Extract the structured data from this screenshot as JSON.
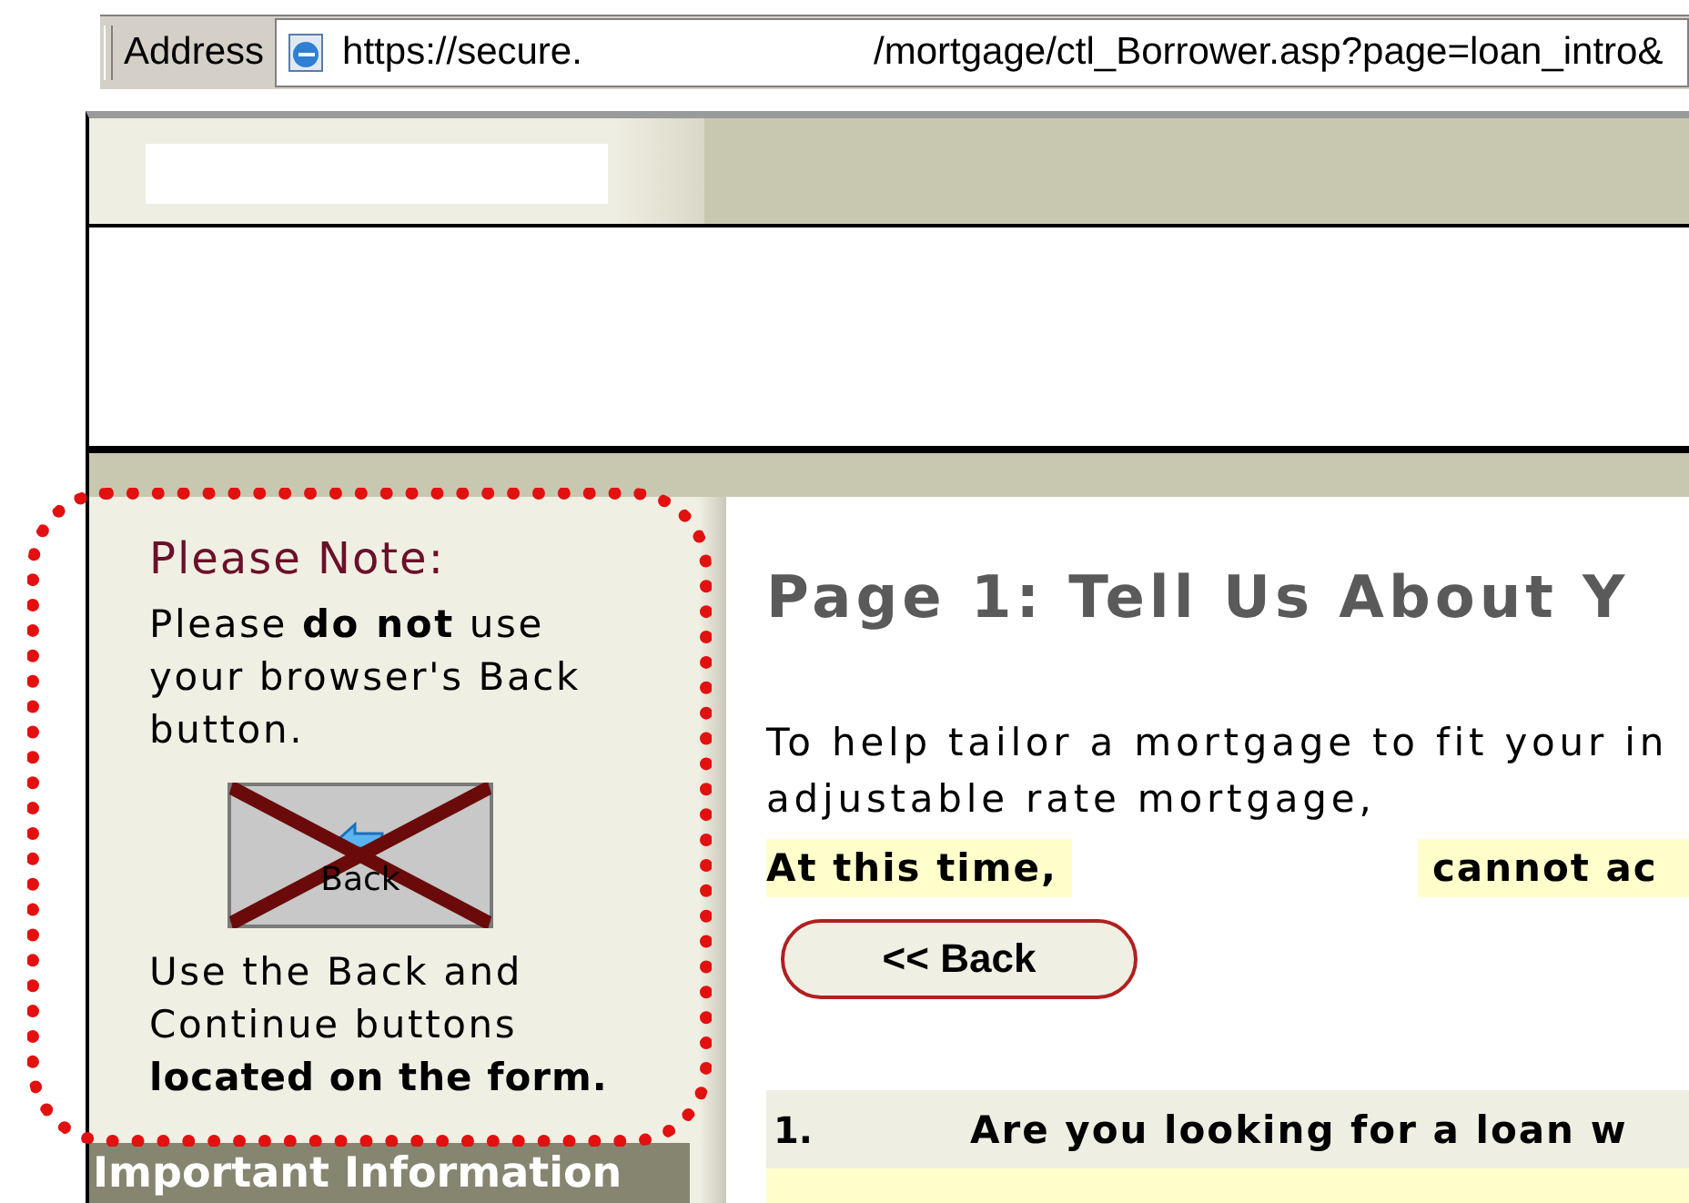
{
  "address_bar": {
    "label": "Address",
    "url_start": "https://secure.",
    "url_end": "/mortgage/ctl_Borrower.asp?page=loan_intro&"
  },
  "sidebar": {
    "note_title": "Please Note:",
    "note_text": "Please **do not** use your browser's Back button.",
    "image_button_label": "Back",
    "instruction": "Use the Back and Continue buttons",
    "instruction_bold": "located on the form.",
    "section_header": "Important Information"
  },
  "main": {
    "heading": "Page 1: Tell Us About Y",
    "intro_lines": [
      "To help tailor a mortgage to fit your in",
      "adjustable rate mortgage,"
    ],
    "notice_start": "At this time,",
    "notice_end": "cannot ac",
    "back_button": "<< Back",
    "questions": [
      {
        "number": "1.",
        "text": "Are you looking for a loan w"
      }
    ]
  }
}
